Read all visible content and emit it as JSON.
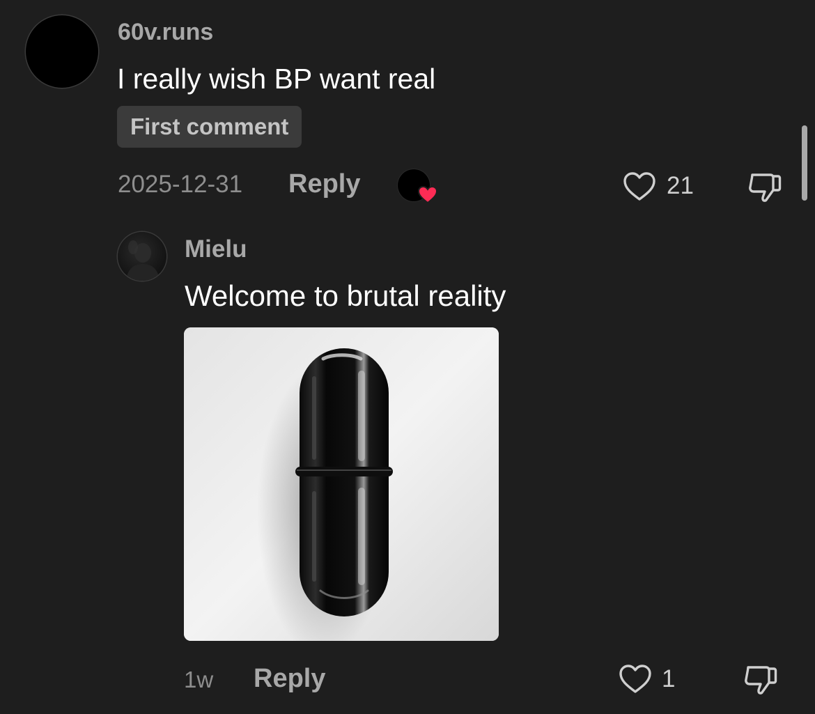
{
  "comment": {
    "username": "60v.runs",
    "text": "I really wish BP want real",
    "badge": "First comment",
    "date": "2025-12-31",
    "reply_label": "Reply",
    "like_count": "21",
    "creator_liked": true
  },
  "reply": {
    "username": "Mielu",
    "text": "Welcome to brutal reality",
    "image": "black-capsule-pill-photo",
    "date": "1w",
    "reply_label": "Reply",
    "like_count": "1"
  },
  "icons": {
    "like": "heart-outline-icon",
    "dislike": "thumbs-down-icon",
    "creator_like": "creator-heart-icon"
  },
  "colors": {
    "background": "#1e1e1e",
    "creator_heart": "#fe2c55",
    "secondary_text": "#a8a8a8"
  }
}
